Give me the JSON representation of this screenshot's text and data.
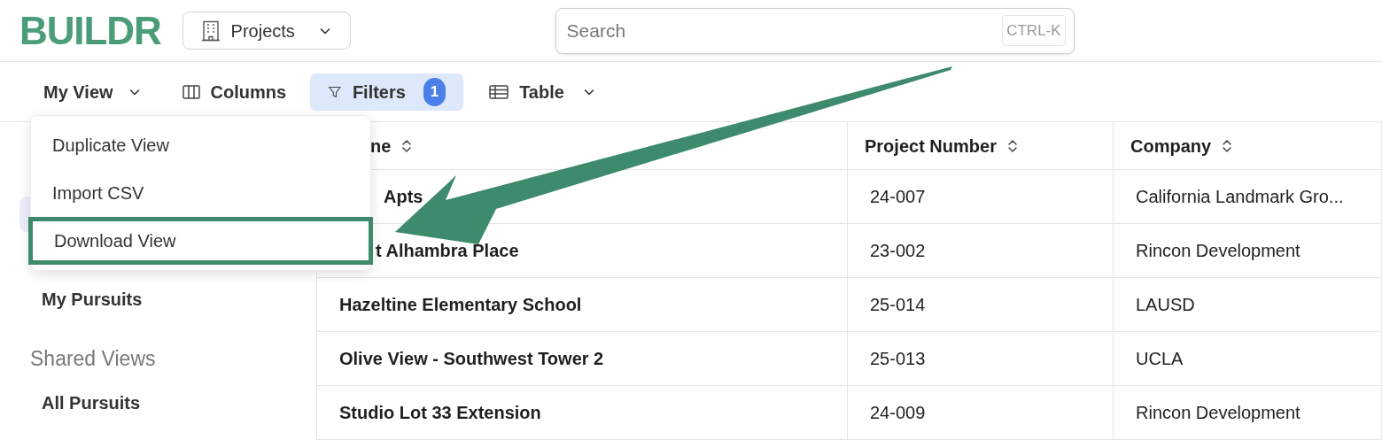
{
  "logo": "BUILDR",
  "module_switcher": {
    "label": "Projects"
  },
  "search": {
    "placeholder": "Search",
    "shortcut": "CTRL-K"
  },
  "toolbar": {
    "view": "My View",
    "columns": "Columns",
    "filters": {
      "label": "Filters",
      "count": "1",
      "active": true
    },
    "layout": "Table"
  },
  "view_menu": {
    "open": true,
    "items": [
      {
        "label": "Duplicate View",
        "highlighted": false
      },
      {
        "label": "Import CSV",
        "highlighted": false
      },
      {
        "label": "Download View",
        "highlighted": true
      }
    ]
  },
  "sidebar": {
    "sections": [
      {
        "items": [
          {
            "selected": true
          },
          {
            "selected": false
          },
          {
            "label": "My Pursuits",
            "selected": false
          }
        ]
      },
      {
        "heading": "Shared Views",
        "items": [
          {
            "label": "All Pursuits",
            "selected": false
          }
        ]
      }
    ]
  },
  "table": {
    "columns": [
      "ne",
      "Project Number",
      "Company"
    ],
    "rows": [
      [
        "Apts",
        "24-007",
        "California Landmark Gro..."
      ],
      [
        "t Alhambra Place",
        "23-002",
        "Rincon Development"
      ],
      [
        "Hazeltine Elementary School",
        "25-014",
        "LAUSD"
      ],
      [
        "Olive View - Southwest Tower 2",
        "25-013",
        "UCLA"
      ],
      [
        "Studio Lot 33 Extension",
        "24-009",
        "Rincon Development"
      ]
    ]
  }
}
